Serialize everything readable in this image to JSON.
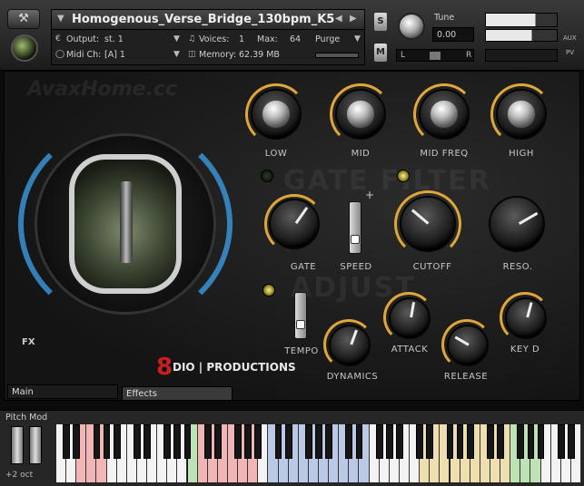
{
  "header": {
    "instrument_name": "Homogenous_Verse_Bridge_130bpm_K5",
    "output_label": "Output:",
    "output_value": "st. 1",
    "voices_label": "Voices:",
    "voices_value": "1",
    "max_label": "Max:",
    "max_value": "64",
    "purge_label": "Purge",
    "midi_label": "Midi Ch:",
    "midi_value": "[A] 1",
    "memory_label": "Memory:",
    "memory_value": "62.39 MB",
    "solo_label": "S",
    "mute_label": "M",
    "tune_label": "Tune",
    "tune_value": "0.00",
    "pan_left": "L",
    "pan_right": "R",
    "aux_label": "AUX",
    "pv_label": "PV"
  },
  "watermark": "AvaxHome.cc",
  "sections": {
    "gate_filter": "GATE FILTER",
    "adjust": "ADJUST"
  },
  "knobs": {
    "low": "LOW",
    "mid": "MID",
    "mid_freq": "MID FREQ",
    "high": "HIGH",
    "gate": "GATE",
    "speed": "SPEED",
    "cutoff": "CUTOFF",
    "reso": "RESO.",
    "tempo": "TEMPO",
    "dynamics": "DYNAMICS",
    "attack": "ATTACK",
    "release": "RELEASE",
    "key_d": "KEY D"
  },
  "fx_label": "FX",
  "brand": "8DIO PRODUCTIONS",
  "brand_num": "8",
  "brand_text": "DIO | PRODUCTIONS",
  "tabs": {
    "main": "Main",
    "effects": "Effects"
  },
  "keyboard": {
    "pitch_mod": "Pitch Mod",
    "octave": "+2 oct"
  },
  "colors": {
    "accent": "#e0a63a",
    "blue_glow": "#3a9be0",
    "red_keys": "#f2b5b5",
    "blue_keys": "#b9c9e6",
    "green_keys": "#bde3b5",
    "yellow_keys": "#f0dfae"
  },
  "icons": {
    "wrench": "wrench-icon",
    "plus": "plus-icon"
  }
}
